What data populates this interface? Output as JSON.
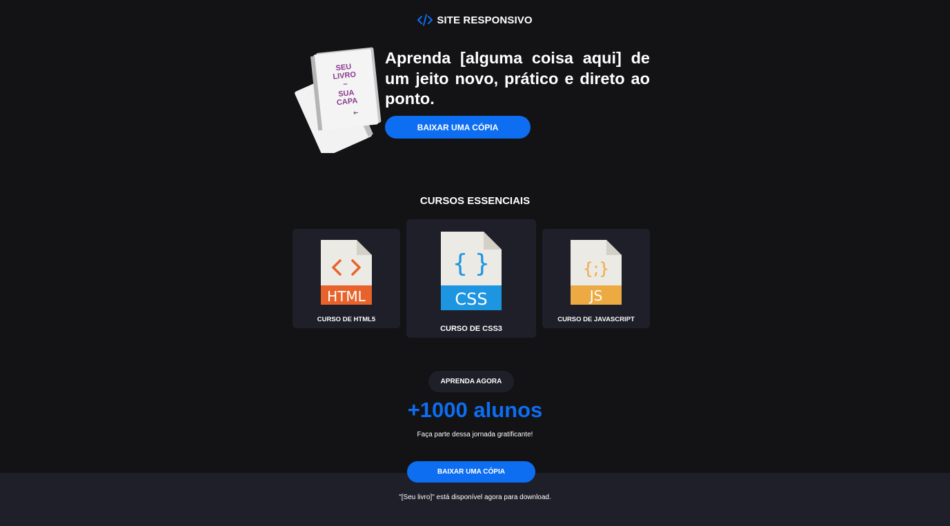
{
  "header": {
    "brand_label": "SITE RESPONSIVO",
    "brand_icon": "code-icon"
  },
  "hero": {
    "book_cover": {
      "line1": "SEU",
      "line2": "LIVRO",
      "separator": "–",
      "line3": "SUA",
      "line4": "CAPA"
    },
    "headline": "Aprenda [alguma coisa aqui] de um jeito novo, prático e direto ao ponto.",
    "cta_label": "BAIXAR UMA CÓPIA"
  },
  "courses": {
    "title": "CURSOS ESSENCIAIS",
    "items": [
      {
        "label": "CURSO DE HTML5",
        "icon": "html-file-icon",
        "symbol": "< >",
        "badge": "HTML",
        "color": "#e8632b"
      },
      {
        "label": "CURSO DE CSS3",
        "icon": "css-file-icon",
        "symbol": "{ }",
        "badge": "CSS",
        "color": "#1e95e0"
      },
      {
        "label": "CURSO DE JAVASCRIPT",
        "icon": "js-file-icon",
        "symbol": "{;}",
        "badge": "JS",
        "color": "#eeaa42"
      }
    ]
  },
  "stats": {
    "pill_label": "APRENDA AGORA",
    "headline": "+1000 alunos",
    "subtext": "Faça parte dessa jornada gratificante!"
  },
  "footer": {
    "cta_label": "BAIXAR UMA CÓPIA",
    "note": "\"[Seu livro]\" está disponível agora para download."
  },
  "colors": {
    "accent": "#0d6ef2",
    "background": "#131316",
    "card": "#1e1f29"
  }
}
